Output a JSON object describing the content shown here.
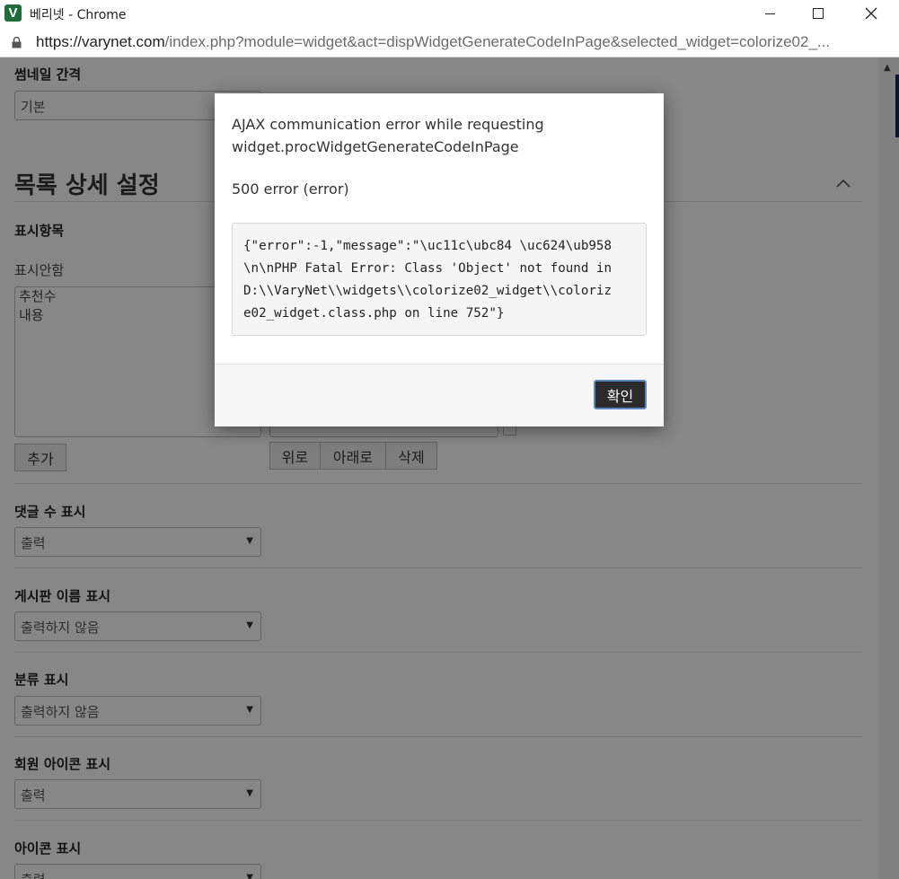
{
  "window": {
    "title": "베리넷 - Chrome",
    "app_icon_glyph": "V",
    "url_host": "https://varynet.com",
    "url_path": "/index.php?module=widget&act=dispWidgetGenerateCodeInPage&selected_widget=colorize02_..."
  },
  "page": {
    "thumbnail_gap_label": "썸네일 간격",
    "thumbnail_gap_value": "기본",
    "list_details_title": "목록 상세 설정",
    "display_items_label": "표시항목",
    "hidden_items_label": "표시안함",
    "hidden_items": [
      "추천수",
      "내용"
    ],
    "add_button": "추가",
    "up_button": "위로",
    "down_button": "아래로",
    "delete_button": "삭제",
    "fields": [
      {
        "label": "댓글 수 표시",
        "value": "출력"
      },
      {
        "label": "게시판 이름 표시",
        "value": "출력하지 않음"
      },
      {
        "label": "분류 표시",
        "value": "출력하지 않음"
      },
      {
        "label": "회원 아이콘 표시",
        "value": "출력"
      },
      {
        "label": "아이콘 표시",
        "value": "출력"
      }
    ]
  },
  "modal": {
    "message_line1": "AJAX communication error while requesting",
    "message_line2": "widget.procWidgetGenerateCodeInPage",
    "status": "500 error (error)",
    "code_lines": [
      "{\"error\":-1,\"message\":\"\\uc11c\\ubc84 \\uc624\\ub958",
      "\\n\\nPHP Fatal Error: Class 'Object' not found in",
      "D:\\\\VaryNet\\\\widgets\\\\colorize02_widget\\\\coloriz",
      "e02_widget.class.php on line 752\"}"
    ],
    "ok_button": "확인"
  },
  "colors": {
    "overlay": "rgba(0,0,0,0.47)",
    "ok_button_bg": "#2b2b2b",
    "ok_button_border": "#5c85c7"
  }
}
